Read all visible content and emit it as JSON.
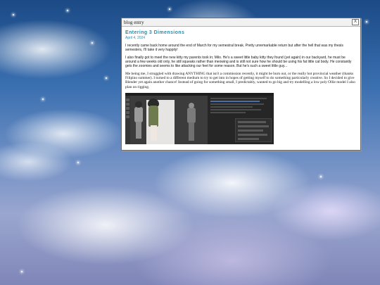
{
  "window": {
    "title": "blog entry",
    "close_label": "X"
  },
  "post": {
    "title": "Entering 3 Dimensions",
    "date": "April 4, 2024",
    "paragraphs": [
      "I recently came back home around the end of March for my semestral break. Pretty unremarkable return but after the hell that was my thesis semesters, I'll take it very happily!",
      "I also finally got to meet the new kitty my parents took in; Milo. He's a sweet little baby kitty they found (yet again) in our backyard, he must be around a few weeks old only, he still squeaks rather than meowing and is still not sure how he should be using his fat little cat body. He constantly gets the zoomies and seems to like attacking our feet for some reason. But he's such a sweet little guy...",
      "Me being me, I struggled with drawing ANYTHING that isn't a commission recently, it might be burn out, or the really hot provincial weather (thanks Filipino summer). I turned to a different medium to try to get into in hopes of getting myself to do something particularly creative. So I decided to give Blender yet again another chance! Instead of going for something small, I predictably, wanted to go big and try modelling a low poly Ollie model I also plan on rigging."
    ],
    "image_alt": "Blender viewport screenshot of a low poly model beside a reference image"
  },
  "colors": {
    "accent": "#2a8cae",
    "window_bg": "#ffffff"
  }
}
